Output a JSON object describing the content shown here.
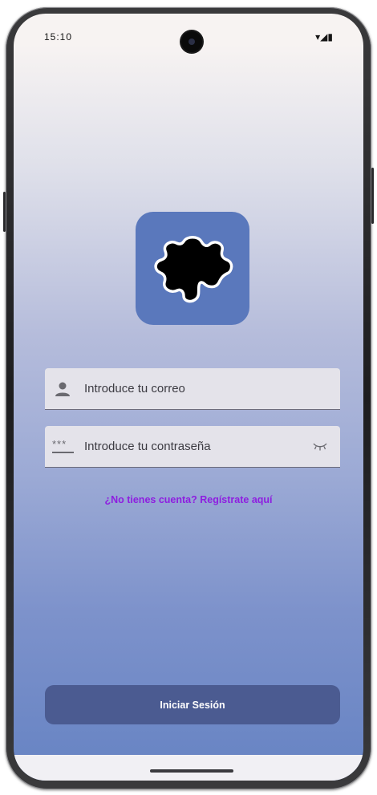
{
  "status_bar": {
    "time": "15:10",
    "right": "▾◢▮"
  },
  "login": {
    "email_placeholder": "Introduce tu correo",
    "password_placeholder": "Introduce tu contraseña",
    "password_mask_icon_text": "***",
    "register_link": "¿No tienes cuenta? Regístrate aquí",
    "submit_label": "Iniciar Sesión"
  },
  "icons": {
    "app_logo": "puzzle-piece-icon",
    "email": "person-icon",
    "password": "password-icon",
    "visibility": "eye-closed-icon"
  },
  "colors": {
    "logo_bg": "#5a78bc",
    "link": "#8e1ee0",
    "button": "#4b5b91",
    "field_bg": "#e4e3ea"
  }
}
